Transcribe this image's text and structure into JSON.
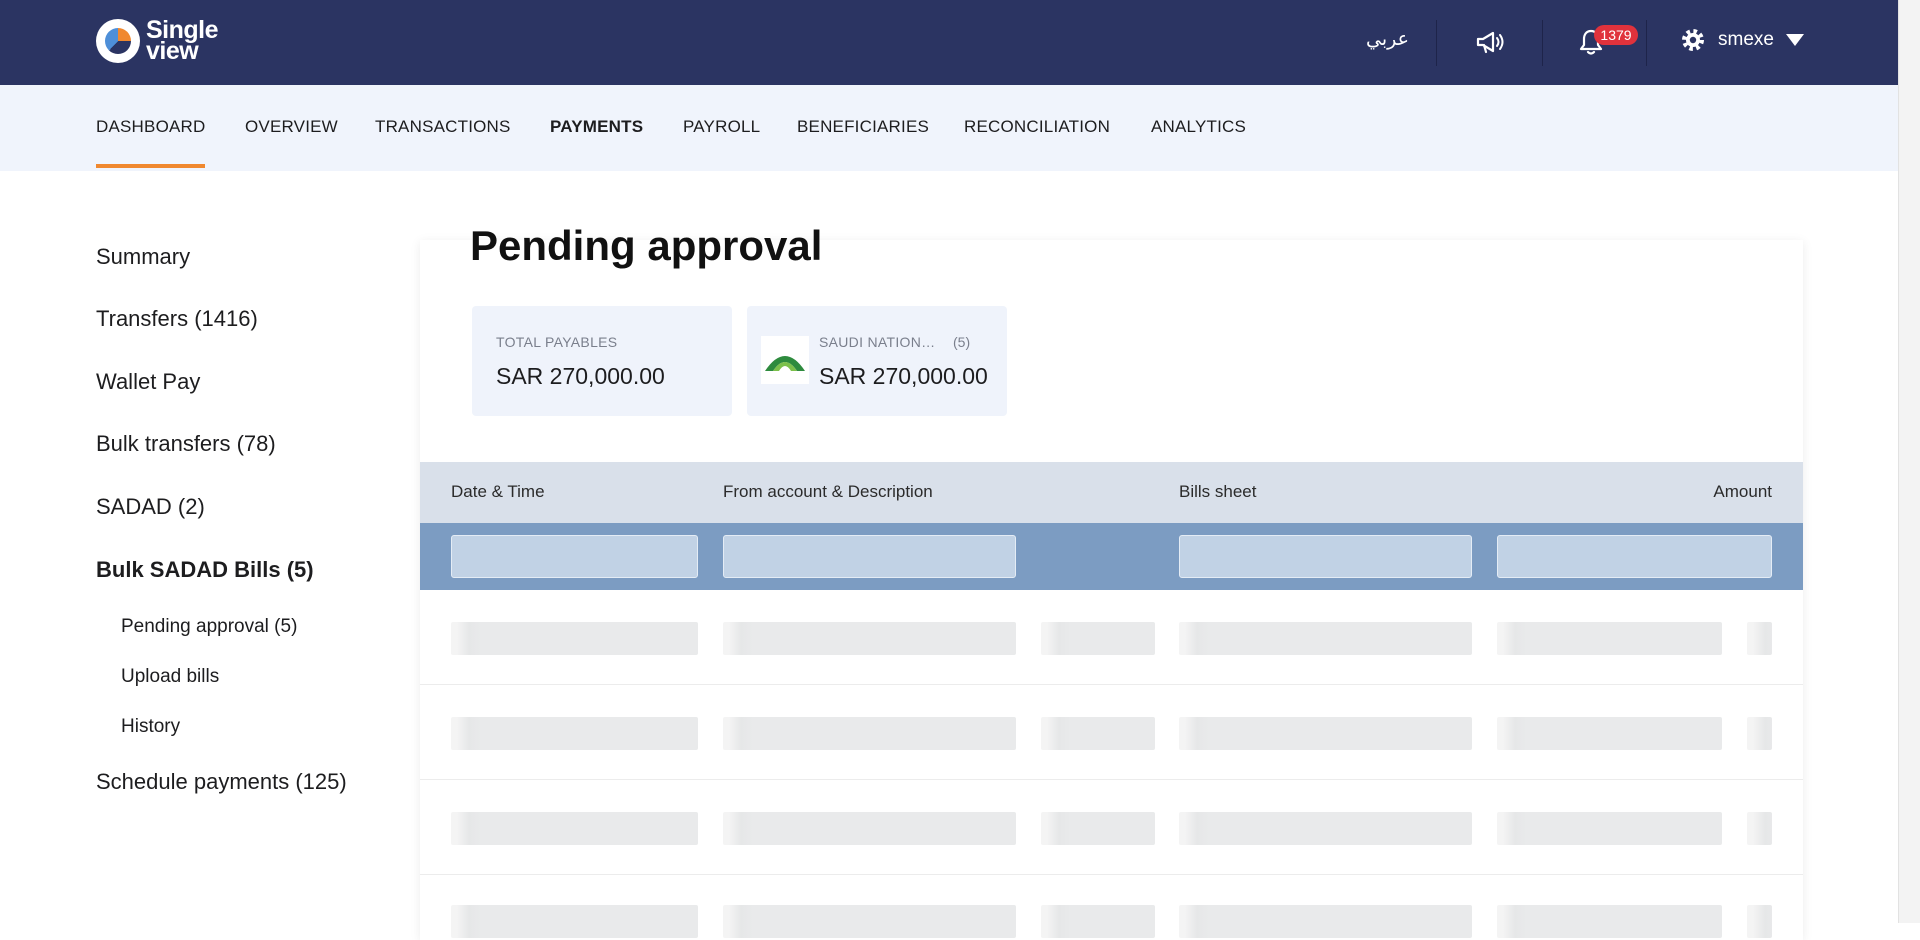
{
  "header": {
    "logo_text_line1": "Single",
    "logo_text_line2": "view",
    "language": "عربي",
    "notification_count": "1379",
    "username": "smexe"
  },
  "nav": {
    "items": [
      "DASHBOARD",
      "OVERVIEW",
      "TRANSACTIONS",
      "PAYMENTS",
      "PAYROLL",
      "BENEFICIARIES",
      "RECONCILIATION",
      "ANALYTICS"
    ],
    "active": "DASHBOARD",
    "accent_color": "#f0882f"
  },
  "sidebar": {
    "items": [
      "Summary",
      "Transfers (1416)",
      "Wallet Pay",
      "Bulk transfers (78)",
      "SADAD (2)",
      "Bulk SADAD Bills (5)",
      "Schedule payments (125)"
    ],
    "active": "Bulk SADAD Bills (5)",
    "sub_items": [
      "Pending approval (5)",
      "Upload bills",
      "History"
    ]
  },
  "main": {
    "title": "Pending approval",
    "summary": {
      "total_label": "TOTAL PAYABLES",
      "total_amount": "SAR 270,000.00",
      "bank_name": "SAUDI NATION…",
      "bank_count": "(5)",
      "bank_amount": "SAR 270,000.00"
    },
    "table": {
      "columns": [
        "Date & Time",
        "From account & Description",
        "Bills sheet",
        "Amount"
      ],
      "loading_rows": 4
    }
  },
  "colors": {
    "topbar": "#2b3462",
    "navbar_bg": "#f0f4fc",
    "table_header": "#d9e0ea",
    "filter_row": "#7c9cc2",
    "badge": "#e0323c"
  },
  "icons": [
    "logo-icon",
    "megaphone-icon",
    "bell-icon",
    "gear-icon",
    "caret-down-icon",
    "bank-logo-icon"
  ]
}
